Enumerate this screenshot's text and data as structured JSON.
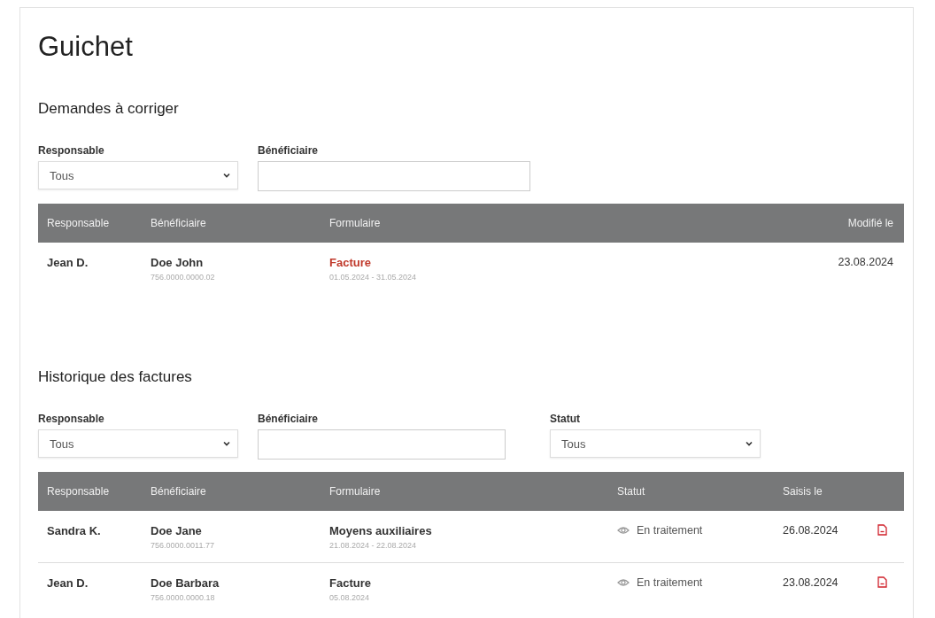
{
  "title": "Guichet",
  "sections": [
    {
      "heading": "Demandes à corriger",
      "filters": [
        {
          "kind": "select",
          "label": "Responsable",
          "value": "Tous"
        },
        {
          "kind": "text",
          "label": "Bénéficiaire"
        }
      ],
      "columns": [
        {
          "label": "Responsable",
          "kind": "resp"
        },
        {
          "label": "Bénéficiaire",
          "kind": "benef"
        },
        {
          "label": "Formulaire",
          "kind": "form"
        },
        {
          "label": "Modifié le",
          "kind": "date_right"
        }
      ],
      "rows": [
        {
          "responsable": "Jean D.",
          "beneficiaire": "Doe John",
          "number": "756.0000.0000.02",
          "formulaire": "Facture",
          "link": true,
          "period": "01.05.2024 - 31.05.2024",
          "date": "23.08.2024"
        }
      ]
    },
    {
      "heading": "Historique des factures",
      "filters": [
        {
          "kind": "select",
          "label": "Responsable",
          "value": "Tous"
        },
        {
          "kind": "text",
          "label": "Bénéficiaire"
        },
        {
          "kind": "select",
          "label": "Statut",
          "value": "Tous"
        }
      ],
      "columns": [
        {
          "label": "Responsable",
          "kind": "resp"
        },
        {
          "label": "Bénéficiaire",
          "kind": "benef"
        },
        {
          "label": "Formulaire",
          "kind": "form"
        },
        {
          "label": "Statut",
          "kind": "status"
        },
        {
          "label": "Saisis le",
          "kind": "date"
        },
        {
          "kind": "action"
        }
      ],
      "rows": [
        {
          "responsable": "Sandra K.",
          "beneficiaire": "Doe Jane",
          "number": "756.0000.0011.77",
          "formulaire": "Moyens auxiliaires",
          "link": false,
          "period": "21.08.2024 - 22.08.2024",
          "status": "En traitement",
          "date": "26.08.2024"
        },
        {
          "responsable": "Jean D.",
          "beneficiaire": "Doe Barbara",
          "number": "756.0000.0000.18",
          "formulaire": "Facture",
          "link": false,
          "period": "05.08.2024",
          "status": "En traitement",
          "date": "23.08.2024"
        }
      ]
    }
  ]
}
